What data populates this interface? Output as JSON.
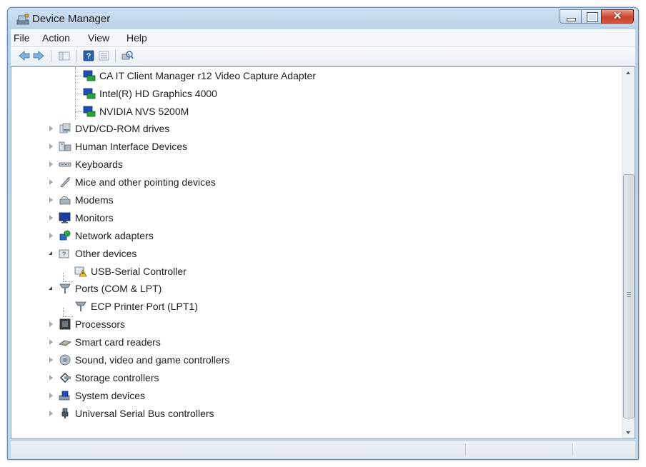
{
  "window": {
    "title": "Device Manager"
  },
  "menu": {
    "file": "File",
    "action": "Action",
    "view": "View",
    "help": "Help"
  },
  "toolbar": {
    "buttons": [
      "back-icon",
      "forward-icon",
      "show-hide-console-tree-icon",
      "help-icon",
      "properties-icon",
      "scan-hardware-icon"
    ]
  },
  "tree": {
    "display_children": [
      "CA IT Client Manager r12 Video Capture Adapter",
      "Intel(R) HD Graphics 4000",
      "NVIDIA NVS 5200M"
    ],
    "categories": [
      "DVD/CD-ROM drives",
      "Human Interface Devices",
      "Keyboards",
      "Mice and other pointing devices",
      "Modems",
      "Monitors",
      "Network adapters"
    ],
    "other_devices": {
      "label": "Other devices",
      "child": "USB-Serial Controller"
    },
    "ports": {
      "label": "Ports (COM & LPT)",
      "child": "ECP Printer Port (LPT1)"
    },
    "categories_after": [
      "Processors",
      "Smart card readers",
      "Sound, video and game controllers",
      "Storage controllers",
      "System devices",
      "Universal Serial Bus controllers"
    ]
  },
  "colors": {
    "title_bar": "#c3d6ea",
    "close_button": "#c9442c",
    "content_bg": "#ffffff"
  }
}
